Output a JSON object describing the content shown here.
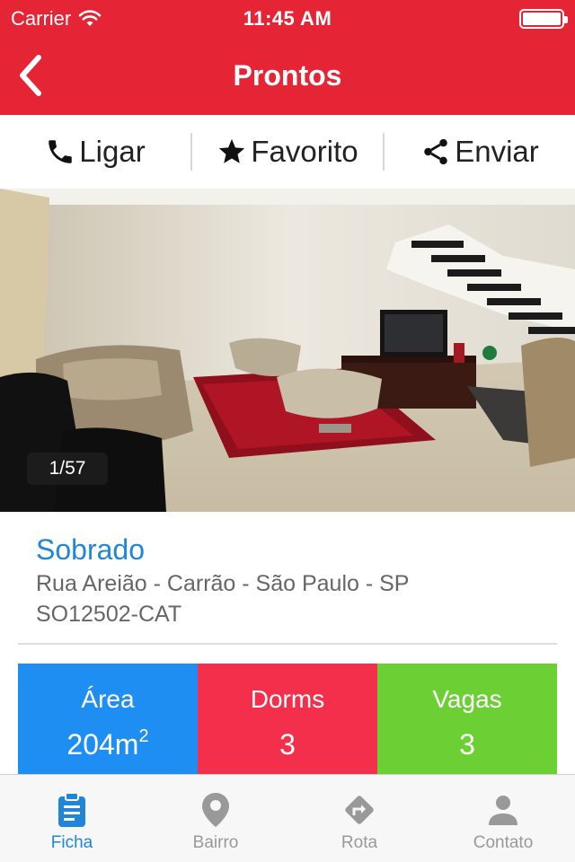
{
  "status_bar": {
    "carrier": "Carrier",
    "time": "11:45 AM"
  },
  "nav": {
    "title": "Prontos"
  },
  "actions": [
    {
      "label": "Ligar",
      "icon": "phone-icon"
    },
    {
      "label": "Favorito",
      "icon": "star-icon"
    },
    {
      "label": "Enviar",
      "icon": "share-icon"
    }
  ],
  "gallery": {
    "counter": "1/57"
  },
  "property": {
    "type": "Sobrado",
    "address": "Rua Areião - Carrão - São Paulo - SP",
    "code": "SO12502-CAT"
  },
  "stats": [
    {
      "label": "Área",
      "value": "204m",
      "sup": "2",
      "color": "#1f8ef2"
    },
    {
      "label": "Dorms",
      "value": "3",
      "color": "#f42f4b"
    },
    {
      "label": "Vagas",
      "value": "3",
      "color": "#6ccf33"
    }
  ],
  "tabs": [
    {
      "label": "Ficha",
      "icon": "clipboard-icon",
      "active": true
    },
    {
      "label": "Bairro",
      "icon": "map-pin-icon"
    },
    {
      "label": "Rota",
      "icon": "directions-icon"
    },
    {
      "label": "Contato",
      "icon": "person-icon"
    }
  ],
  "colors": {
    "header": "#e52535",
    "accent": "#1f86d9",
    "inactive_tab": "#999999"
  }
}
